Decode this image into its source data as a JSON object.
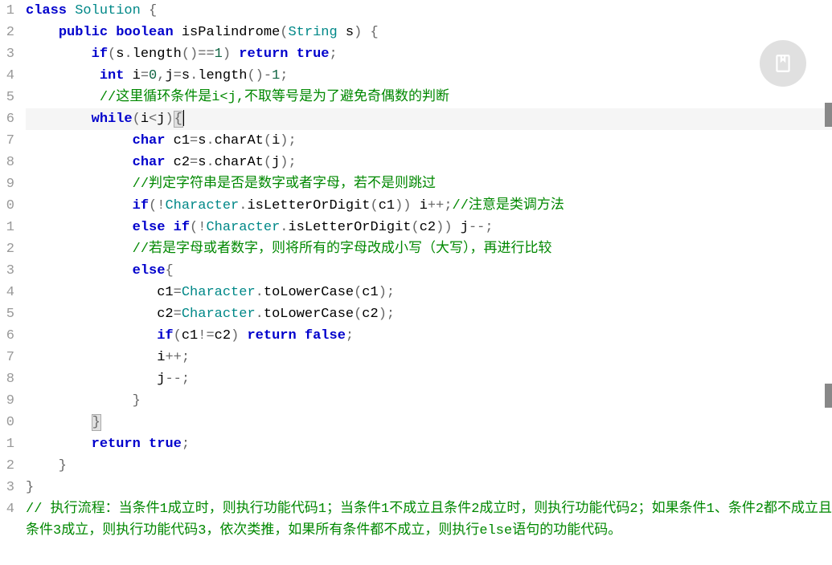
{
  "code": {
    "lines": [
      {
        "n": "1",
        "raw": [
          {
            "t": "class ",
            "c": "kw"
          },
          {
            "t": "Solution ",
            "c": "cls"
          },
          {
            "t": "{",
            "c": "pn"
          }
        ]
      },
      {
        "n": "2",
        "raw": [
          {
            "t": "    ",
            "c": ""
          },
          {
            "t": "public ",
            "c": "kw"
          },
          {
            "t": "boolean ",
            "c": "kw"
          },
          {
            "t": "isPalindrome",
            "c": "mth"
          },
          {
            "t": "(",
            "c": "pn"
          },
          {
            "t": "String ",
            "c": "cls"
          },
          {
            "t": "s",
            "c": "id"
          },
          {
            "t": ") {",
            "c": "pn"
          }
        ]
      },
      {
        "n": "3",
        "raw": [
          {
            "t": "        ",
            "c": ""
          },
          {
            "t": "if",
            "c": "kw"
          },
          {
            "t": "(",
            "c": "pn"
          },
          {
            "t": "s",
            "c": "id"
          },
          {
            "t": ".",
            "c": "pn"
          },
          {
            "t": "length",
            "c": "mth"
          },
          {
            "t": "()==",
            "c": "pn"
          },
          {
            "t": "1",
            "c": "num"
          },
          {
            "t": ") ",
            "c": "pn"
          },
          {
            "t": "return ",
            "c": "kw"
          },
          {
            "t": "true",
            "c": "kw"
          },
          {
            "t": ";",
            "c": "pn"
          }
        ]
      },
      {
        "n": "4",
        "raw": [
          {
            "t": "         ",
            "c": ""
          },
          {
            "t": "int ",
            "c": "kw"
          },
          {
            "t": "i",
            "c": "id"
          },
          {
            "t": "=",
            "c": "op"
          },
          {
            "t": "0",
            "c": "num"
          },
          {
            "t": ",",
            "c": "pn"
          },
          {
            "t": "j",
            "c": "id"
          },
          {
            "t": "=",
            "c": "op"
          },
          {
            "t": "s",
            "c": "id"
          },
          {
            "t": ".",
            "c": "pn"
          },
          {
            "t": "length",
            "c": "mth"
          },
          {
            "t": "()-",
            "c": "pn"
          },
          {
            "t": "1",
            "c": "num"
          },
          {
            "t": ";",
            "c": "pn"
          }
        ]
      },
      {
        "n": "5",
        "raw": [
          {
            "t": "         ",
            "c": ""
          },
          {
            "t": "//这里循环条件是i<j,不取等号是为了避免奇偶数的判断",
            "c": "cmt"
          }
        ]
      },
      {
        "n": "6",
        "highlighted": true,
        "cursor": true,
        "raw": [
          {
            "t": "        ",
            "c": ""
          },
          {
            "t": "while",
            "c": "kw"
          },
          {
            "t": "(",
            "c": "pn"
          },
          {
            "t": "i",
            "c": "id"
          },
          {
            "t": "<",
            "c": "op"
          },
          {
            "t": "j",
            "c": "id"
          },
          {
            "t": ")",
            "c": "pn"
          },
          {
            "t": "{",
            "c": "pn bracket-hl"
          }
        ]
      },
      {
        "n": "7",
        "raw": [
          {
            "t": "             ",
            "c": ""
          },
          {
            "t": "char ",
            "c": "kw"
          },
          {
            "t": "c1",
            "c": "id"
          },
          {
            "t": "=",
            "c": "op"
          },
          {
            "t": "s",
            "c": "id"
          },
          {
            "t": ".",
            "c": "pn"
          },
          {
            "t": "charAt",
            "c": "mth"
          },
          {
            "t": "(",
            "c": "pn"
          },
          {
            "t": "i",
            "c": "id"
          },
          {
            "t": ");",
            "c": "pn"
          }
        ]
      },
      {
        "n": "8",
        "raw": [
          {
            "t": "             ",
            "c": ""
          },
          {
            "t": "char ",
            "c": "kw"
          },
          {
            "t": "c2",
            "c": "id"
          },
          {
            "t": "=",
            "c": "op"
          },
          {
            "t": "s",
            "c": "id"
          },
          {
            "t": ".",
            "c": "pn"
          },
          {
            "t": "charAt",
            "c": "mth"
          },
          {
            "t": "(",
            "c": "pn"
          },
          {
            "t": "j",
            "c": "id"
          },
          {
            "t": ");",
            "c": "pn"
          }
        ]
      },
      {
        "n": "9",
        "raw": [
          {
            "t": "             ",
            "c": ""
          },
          {
            "t": "//判定字符串是否是数字或者字母，若不是则跳过",
            "c": "cmt"
          }
        ]
      },
      {
        "n": "0",
        "raw": [
          {
            "t": "             ",
            "c": ""
          },
          {
            "t": "if",
            "c": "kw"
          },
          {
            "t": "(!",
            "c": "pn"
          },
          {
            "t": "Character",
            "c": "cls"
          },
          {
            "t": ".",
            "c": "pn"
          },
          {
            "t": "isLetterOrDigit",
            "c": "mth"
          },
          {
            "t": "(",
            "c": "pn"
          },
          {
            "t": "c1",
            "c": "id"
          },
          {
            "t": ")) ",
            "c": "pn"
          },
          {
            "t": "i",
            "c": "id"
          },
          {
            "t": "++;",
            "c": "pn"
          },
          {
            "t": "//注意是类调方法",
            "c": "cmt"
          }
        ]
      },
      {
        "n": "1",
        "raw": [
          {
            "t": "             ",
            "c": ""
          },
          {
            "t": "else ",
            "c": "kw"
          },
          {
            "t": "if",
            "c": "kw"
          },
          {
            "t": "(!",
            "c": "pn"
          },
          {
            "t": "Character",
            "c": "cls"
          },
          {
            "t": ".",
            "c": "pn"
          },
          {
            "t": "isLetterOrDigit",
            "c": "mth"
          },
          {
            "t": "(",
            "c": "pn"
          },
          {
            "t": "c2",
            "c": "id"
          },
          {
            "t": ")) ",
            "c": "pn"
          },
          {
            "t": "j",
            "c": "id"
          },
          {
            "t": "--;",
            "c": "pn"
          }
        ]
      },
      {
        "n": "2",
        "raw": [
          {
            "t": "             ",
            "c": ""
          },
          {
            "t": "//若是字母或者数字，则将所有的字母改成小写（大写），再进行比较",
            "c": "cmt"
          }
        ]
      },
      {
        "n": "3",
        "raw": [
          {
            "t": "             ",
            "c": ""
          },
          {
            "t": "else",
            "c": "kw"
          },
          {
            "t": "{",
            "c": "pn"
          }
        ]
      },
      {
        "n": "4",
        "raw": [
          {
            "t": "                ",
            "c": ""
          },
          {
            "t": "c1",
            "c": "id"
          },
          {
            "t": "=",
            "c": "op"
          },
          {
            "t": "Character",
            "c": "cls"
          },
          {
            "t": ".",
            "c": "pn"
          },
          {
            "t": "toLowerCase",
            "c": "mth"
          },
          {
            "t": "(",
            "c": "pn"
          },
          {
            "t": "c1",
            "c": "id"
          },
          {
            "t": ");",
            "c": "pn"
          }
        ]
      },
      {
        "n": "5",
        "raw": [
          {
            "t": "                ",
            "c": ""
          },
          {
            "t": "c2",
            "c": "id"
          },
          {
            "t": "=",
            "c": "op"
          },
          {
            "t": "Character",
            "c": "cls"
          },
          {
            "t": ".",
            "c": "pn"
          },
          {
            "t": "toLowerCase",
            "c": "mth"
          },
          {
            "t": "(",
            "c": "pn"
          },
          {
            "t": "c2",
            "c": "id"
          },
          {
            "t": ");",
            "c": "pn"
          }
        ]
      },
      {
        "n": "6",
        "raw": [
          {
            "t": "                ",
            "c": ""
          },
          {
            "t": "if",
            "c": "kw"
          },
          {
            "t": "(",
            "c": "pn"
          },
          {
            "t": "c1",
            "c": "id"
          },
          {
            "t": "!=",
            "c": "op"
          },
          {
            "t": "c2",
            "c": "id"
          },
          {
            "t": ") ",
            "c": "pn"
          },
          {
            "t": "return ",
            "c": "kw"
          },
          {
            "t": "false",
            "c": "kw"
          },
          {
            "t": ";",
            "c": "pn"
          }
        ]
      },
      {
        "n": "7",
        "raw": [
          {
            "t": "                ",
            "c": ""
          },
          {
            "t": "i",
            "c": "id"
          },
          {
            "t": "++;",
            "c": "pn"
          }
        ]
      },
      {
        "n": "8",
        "raw": [
          {
            "t": "                ",
            "c": ""
          },
          {
            "t": "j",
            "c": "id"
          },
          {
            "t": "--;",
            "c": "pn"
          }
        ]
      },
      {
        "n": "9",
        "raw": [
          {
            "t": "             }",
            "c": "pn"
          }
        ]
      },
      {
        "n": "0",
        "raw": [
          {
            "t": "        ",
            "c": ""
          },
          {
            "t": "}",
            "c": "pn bracket-hl"
          }
        ]
      },
      {
        "n": "1",
        "raw": [
          {
            "t": "        ",
            "c": ""
          },
          {
            "t": "return ",
            "c": "kw"
          },
          {
            "t": "true",
            "c": "kw"
          },
          {
            "t": ";",
            "c": "pn"
          }
        ]
      },
      {
        "n": "2",
        "raw": [
          {
            "t": "    }",
            "c": "pn"
          }
        ]
      },
      {
        "n": "3",
        "raw": [
          {
            "t": "}",
            "c": "pn"
          }
        ]
      },
      {
        "n": "4",
        "wrap": true,
        "raw": [
          {
            "t": "// 执行流程：当条件1成立时，则执行功能代码1；当条件1不成立且条件2成立时，则执行功能代码2；如果条件1、条件2都不成立且条件3成立，则执行功能代码3，依次类推，如果所有条件都不成立，则执行else语句的功能代码。",
            "c": "cmt"
          }
        ]
      }
    ]
  },
  "floating_button": {
    "label": "bookmark"
  }
}
